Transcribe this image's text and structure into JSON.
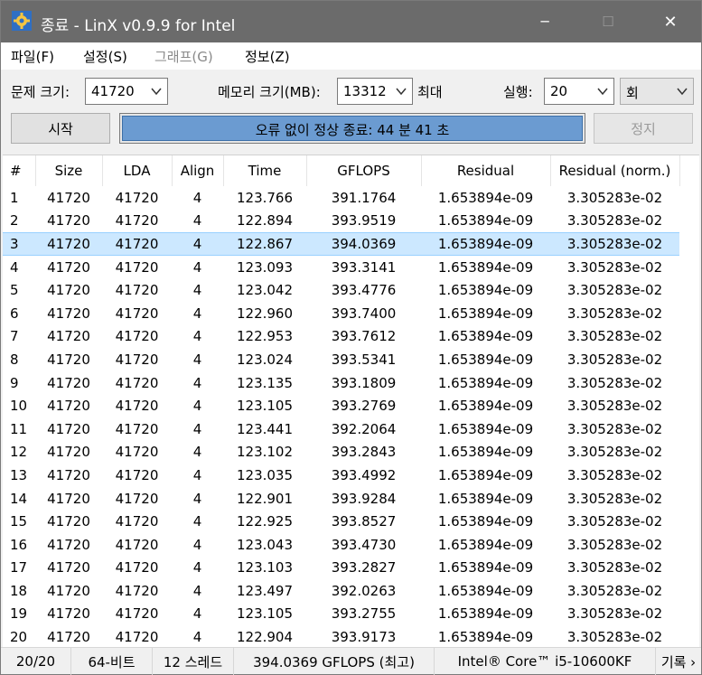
{
  "window": {
    "title": "종료 - LinX v0.9.9 for Intel",
    "controls": {
      "minimize": "─",
      "maximize": "☐",
      "close": "✕"
    }
  },
  "menu": [
    "파일(F)",
    "설정(S)",
    "그래프(G)",
    "정보(Z)"
  ],
  "options": {
    "problem_size_label": "문제 크기:",
    "problem_size_value": "41720",
    "memory_label": "메모리 크기(MB):",
    "memory_value": "13312",
    "max_label": "최대",
    "runs_label": "실행:",
    "runs_value": "20",
    "runs_unit": "회"
  },
  "actions": {
    "start_label": "시작",
    "progress_text": "오류 없이 정상 종료: 44 분 41 초",
    "progress_fraction": 1.0,
    "stop_label": "정지"
  },
  "table": {
    "headers": [
      "#",
      "Size",
      "LDA",
      "Align",
      "Time",
      "GFLOPS",
      "Residual",
      "Residual (norm.)"
    ],
    "selected_row": 3,
    "rows": [
      [
        "1",
        "41720",
        "41720",
        "4",
        "123.766",
        "391.1764",
        "1.653894e-09",
        "3.305283e-02"
      ],
      [
        "2",
        "41720",
        "41720",
        "4",
        "122.894",
        "393.9519",
        "1.653894e-09",
        "3.305283e-02"
      ],
      [
        "3",
        "41720",
        "41720",
        "4",
        "122.867",
        "394.0369",
        "1.653894e-09",
        "3.305283e-02"
      ],
      [
        "4",
        "41720",
        "41720",
        "4",
        "123.093",
        "393.3141",
        "1.653894e-09",
        "3.305283e-02"
      ],
      [
        "5",
        "41720",
        "41720",
        "4",
        "123.042",
        "393.4776",
        "1.653894e-09",
        "3.305283e-02"
      ],
      [
        "6",
        "41720",
        "41720",
        "4",
        "122.960",
        "393.7400",
        "1.653894e-09",
        "3.305283e-02"
      ],
      [
        "7",
        "41720",
        "41720",
        "4",
        "122.953",
        "393.7612",
        "1.653894e-09",
        "3.305283e-02"
      ],
      [
        "8",
        "41720",
        "41720",
        "4",
        "123.024",
        "393.5341",
        "1.653894e-09",
        "3.305283e-02"
      ],
      [
        "9",
        "41720",
        "41720",
        "4",
        "123.135",
        "393.1809",
        "1.653894e-09",
        "3.305283e-02"
      ],
      [
        "10",
        "41720",
        "41720",
        "4",
        "123.105",
        "393.2769",
        "1.653894e-09",
        "3.305283e-02"
      ],
      [
        "11",
        "41720",
        "41720",
        "4",
        "123.441",
        "392.2064",
        "1.653894e-09",
        "3.305283e-02"
      ],
      [
        "12",
        "41720",
        "41720",
        "4",
        "123.102",
        "393.2843",
        "1.653894e-09",
        "3.305283e-02"
      ],
      [
        "13",
        "41720",
        "41720",
        "4",
        "123.035",
        "393.4992",
        "1.653894e-09",
        "3.305283e-02"
      ],
      [
        "14",
        "41720",
        "41720",
        "4",
        "122.901",
        "393.9284",
        "1.653894e-09",
        "3.305283e-02"
      ],
      [
        "15",
        "41720",
        "41720",
        "4",
        "122.925",
        "393.8527",
        "1.653894e-09",
        "3.305283e-02"
      ],
      [
        "16",
        "41720",
        "41720",
        "4",
        "123.043",
        "393.4730",
        "1.653894e-09",
        "3.305283e-02"
      ],
      [
        "17",
        "41720",
        "41720",
        "4",
        "123.103",
        "393.2827",
        "1.653894e-09",
        "3.305283e-02"
      ],
      [
        "18",
        "41720",
        "41720",
        "4",
        "123.497",
        "392.0263",
        "1.653894e-09",
        "3.305283e-02"
      ],
      [
        "19",
        "41720",
        "41720",
        "4",
        "123.105",
        "393.2755",
        "1.653894e-09",
        "3.305283e-02"
      ],
      [
        "20",
        "41720",
        "41720",
        "4",
        "122.904",
        "393.9173",
        "1.653894e-09",
        "3.305283e-02"
      ]
    ]
  },
  "status": {
    "runs": "20/20",
    "bits": "64-비트",
    "threads": "12 스레드",
    "peak": "394.0369 GFLOPS (최고)",
    "cpu": "Intel® Core™ i5-10600KF",
    "log": "기록 ›"
  },
  "colors": {
    "titlebar": "#6b6b6b",
    "progress_fill": "#6b9bd1",
    "selected_row": "#cce8ff"
  }
}
